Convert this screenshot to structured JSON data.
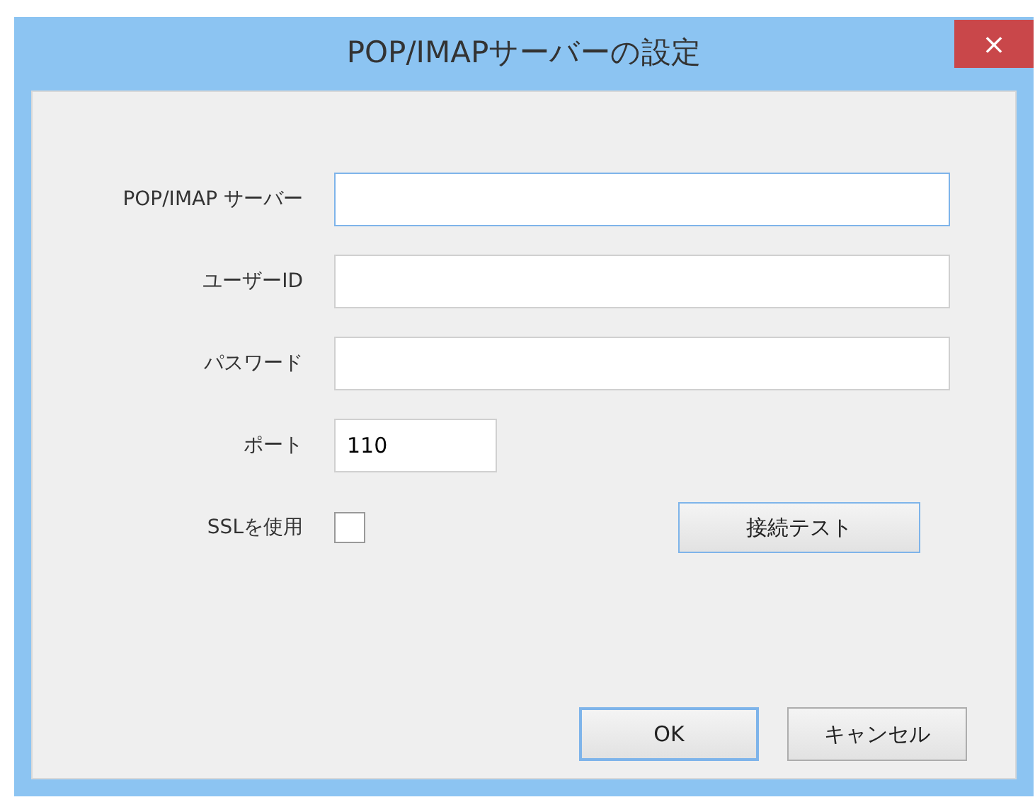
{
  "window": {
    "title": "POP/IMAPサーバーの設定",
    "close": "×"
  },
  "fields": [
    {
      "kind": "text",
      "label": "POP/IMAP サーバー",
      "focused": true
    },
    {
      "kind": "text",
      "label": "ユーザーID",
      "focused": false
    },
    {
      "kind": "text",
      "label": "パスワード",
      "focused": false
    },
    {
      "kind": "number",
      "label": "ポート",
      "value": "110",
      "focused": false
    },
    {
      "kind": "checkbox",
      "label": "SSLを使用",
      "checked": false,
      "button": "接続テスト"
    }
  ],
  "buttons": [
    {
      "label": "OK",
      "default": true
    },
    {
      "label": "キャンセル",
      "default": false
    }
  ]
}
